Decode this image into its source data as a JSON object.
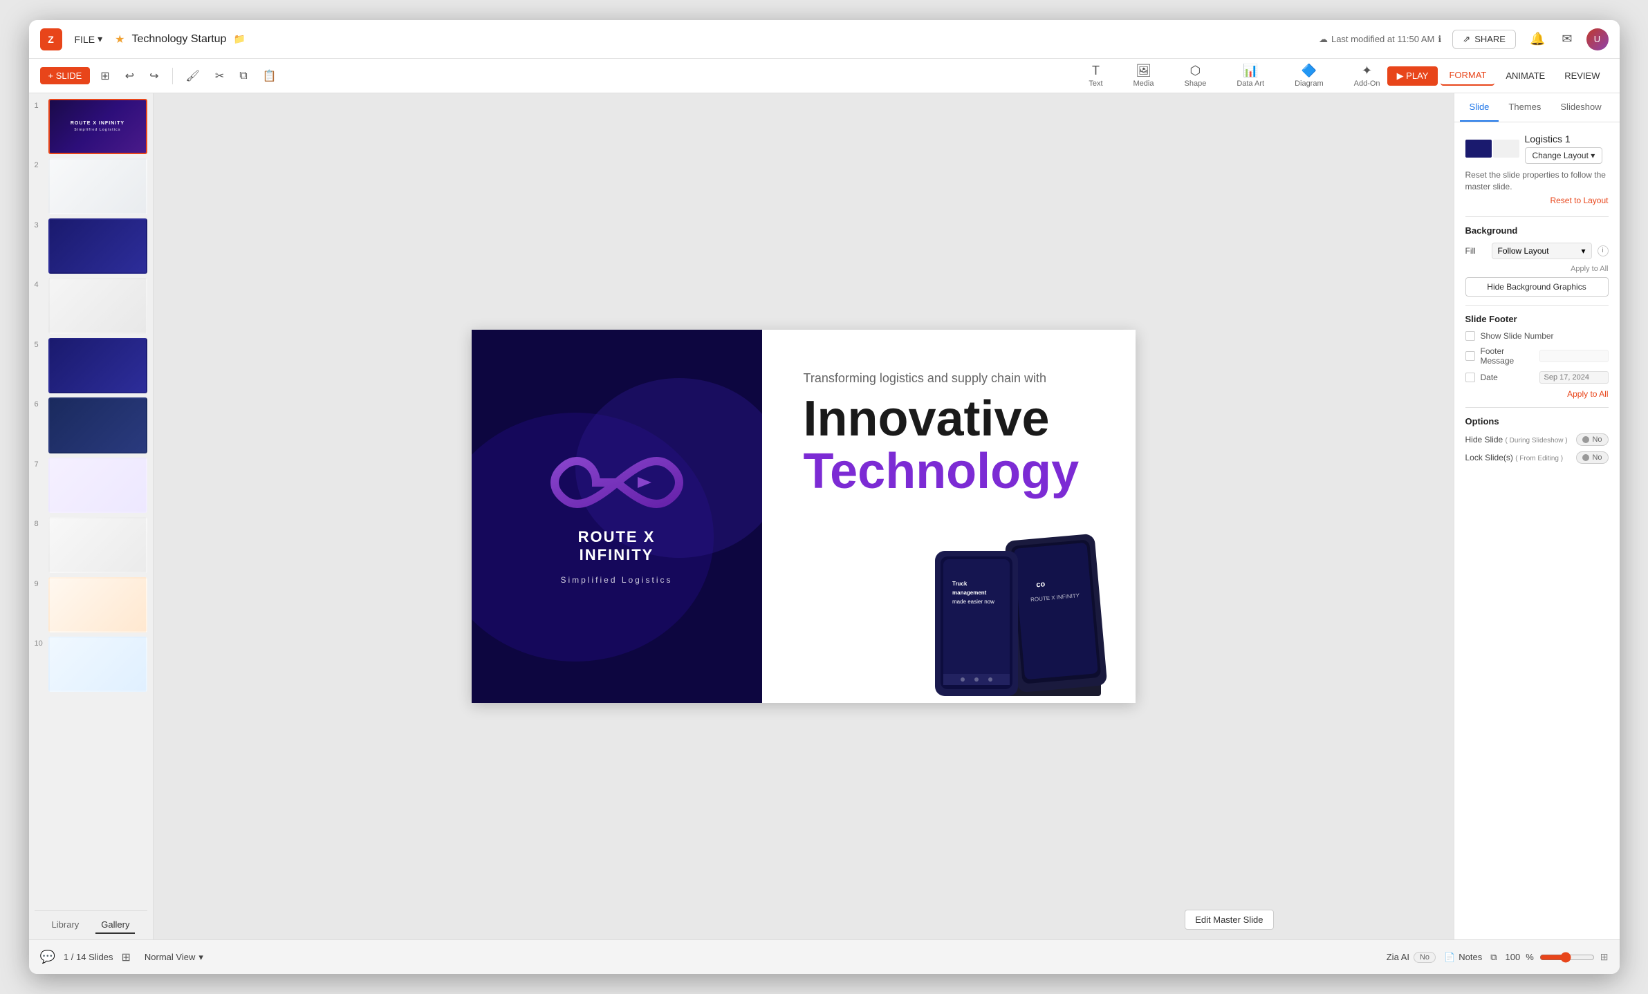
{
  "app": {
    "logo_text": "Z",
    "file_label": "FILE",
    "star": "★",
    "project_title": "Technology Startup",
    "folder_icon": "📁",
    "last_modified": "Last modified at 11:50 AM",
    "share_label": "SHARE",
    "bell_icon": "🔔",
    "mail_icon": "✉",
    "avatar_initials": "U"
  },
  "toolbar": {
    "slide_label": "+ SLIDE",
    "undo_icon": "↩",
    "redo_icon": "↪",
    "tools": [
      {
        "label": "Text",
        "icon": "T"
      },
      {
        "label": "Media",
        "icon": "🖼"
      },
      {
        "label": "Shape",
        "icon": "⬡"
      },
      {
        "label": "Data Art",
        "icon": "📊"
      },
      {
        "label": "Diagram",
        "icon": "⬡"
      },
      {
        "label": "Add-On",
        "icon": "⬡"
      }
    ],
    "play_label": "▶ PLAY",
    "format_label": "FORMAT",
    "animate_label": "ANIMATE",
    "review_label": "REVIEW"
  },
  "slide_panel": {
    "slides": [
      {
        "number": 1,
        "type": "dark-purple"
      },
      {
        "number": 2,
        "type": "light"
      },
      {
        "number": 3,
        "type": "dark-blue"
      },
      {
        "number": 4,
        "type": "light"
      },
      {
        "number": 5,
        "type": "dark-blue"
      },
      {
        "number": 6,
        "type": "dark-navy"
      },
      {
        "number": 7,
        "type": "light-purple"
      },
      {
        "number": 8,
        "type": "white"
      },
      {
        "number": 9,
        "type": "warm"
      },
      {
        "number": 10,
        "type": "light-blue"
      }
    ],
    "library_label": "Library",
    "gallery_label": "Gallery"
  },
  "main_slide": {
    "subtitle": "Transforming logistics and supply chain with",
    "headline1": "Innovative",
    "headline2": "Technology",
    "brand_name": "ROUTE X INFINITY",
    "tagline": "Simplified Logistics"
  },
  "right_panel": {
    "tabs": [
      "Slide",
      "Themes",
      "Slideshow"
    ],
    "active_tab": "Slide",
    "layout_name": "Logistics 1",
    "change_layout_label": "Change Layout ▾",
    "reset_text": "Reset the slide properties to follow the master slide.",
    "reset_layout_label": "Reset to Layout",
    "background_title": "Background",
    "fill_label": "Fill",
    "fill_value": "Follow Layout",
    "apply_to_all_label": "Apply to All",
    "hide_bg_label": "Hide Background Graphics",
    "footer_title": "Slide Footer",
    "show_slide_number_label": "Show Slide Number",
    "footer_message_label": "Footer Message",
    "date_label": "Date",
    "date_placeholder": "Sep 17, 2024",
    "apply_all_label": "Apply to All",
    "options_title": "Options",
    "hide_slide_label": "Hide Slide",
    "hide_slide_sub": "( During Slideshow )",
    "lock_slide_label": "Lock Slide(s)",
    "lock_slide_sub": "( From Editing )",
    "no_label": "No",
    "info_icon": "i"
  },
  "bottom_bar": {
    "chat_icon": "💬",
    "slide_current": "1",
    "slide_total": "14 Slides",
    "grid_icon": "⊞",
    "view_mode": "Normal View",
    "chevron": "▾",
    "zia_label": "Zia AI",
    "no_label": "No",
    "notes_icon": "📄",
    "notes_label": "Notes",
    "duplicate_icon": "⧉",
    "zoom_level": "100",
    "zoom_percent": "%"
  },
  "edit_master_btn": "Edit Master Slide"
}
